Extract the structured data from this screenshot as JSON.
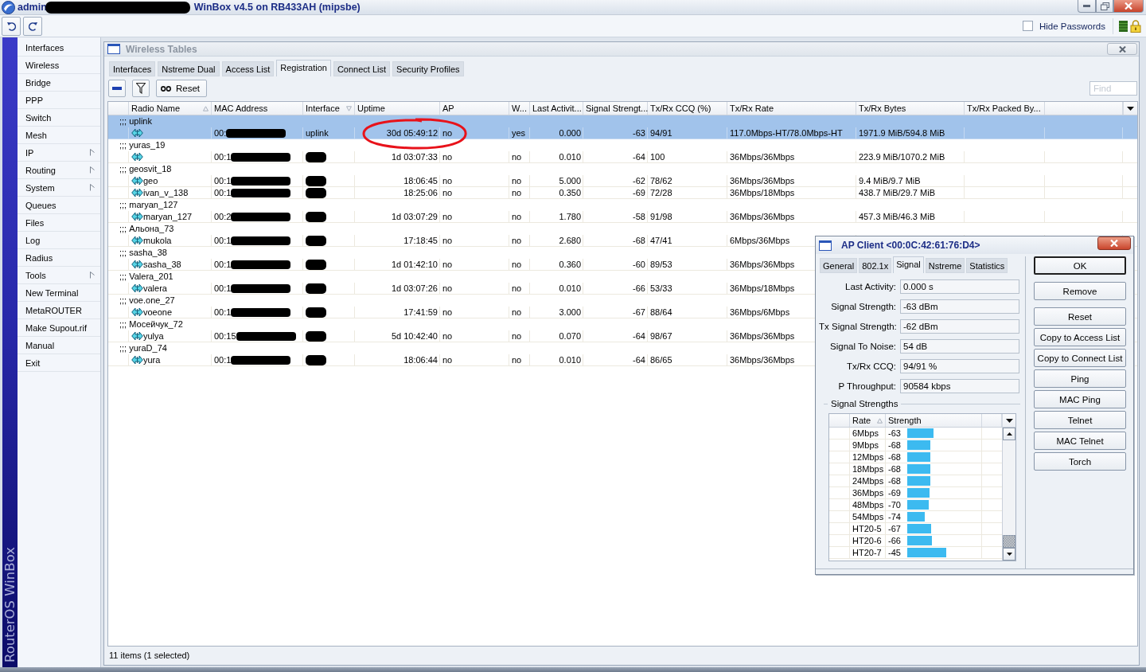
{
  "window": {
    "user": "admin",
    "title": "WinBox v4.5 on RB433AH (mipsbe)"
  },
  "toolbar": {
    "hide_passwords": {
      "label": "Hide Passwords",
      "checked": false
    }
  },
  "sidebar": {
    "brand": "RouterOS WinBox",
    "items": [
      {
        "label": "Interfaces",
        "submenu": false
      },
      {
        "label": "Wireless",
        "submenu": false
      },
      {
        "label": "Bridge",
        "submenu": false
      },
      {
        "label": "PPP",
        "submenu": false
      },
      {
        "label": "Switch",
        "submenu": false
      },
      {
        "label": "Mesh",
        "submenu": false
      },
      {
        "label": "IP",
        "submenu": true
      },
      {
        "label": "Routing",
        "submenu": true
      },
      {
        "label": "System",
        "submenu": true
      },
      {
        "label": "Queues",
        "submenu": false
      },
      {
        "label": "Files",
        "submenu": false
      },
      {
        "label": "Log",
        "submenu": false
      },
      {
        "label": "Radius",
        "submenu": false
      },
      {
        "label": "Tools",
        "submenu": true
      },
      {
        "label": "New Terminal",
        "submenu": false
      },
      {
        "label": "MetaROUTER",
        "submenu": false
      },
      {
        "label": "Make Supout.rif",
        "submenu": false
      },
      {
        "label": "Manual",
        "submenu": false
      },
      {
        "label": "Exit",
        "submenu": false
      }
    ]
  },
  "tables_window": {
    "title": "Wireless Tables",
    "tabs": [
      {
        "label": "Interfaces",
        "selected": false
      },
      {
        "label": "Nstreme Dual",
        "selected": false
      },
      {
        "label": "Access List",
        "selected": false
      },
      {
        "label": "Registration",
        "selected": true
      },
      {
        "label": "Connect List",
        "selected": false
      },
      {
        "label": "Security Profiles",
        "selected": false
      }
    ],
    "reset_label": "Reset",
    "find_placeholder": "Find",
    "columns": [
      {
        "label": "Radio Name",
        "sorted": true,
        "descending": false
      },
      {
        "label": "MAC Address",
        "sorted": false
      },
      {
        "label": "Interface",
        "sorted": true,
        "descending": true
      },
      {
        "label": "Uptime",
        "sorted": false
      },
      {
        "label": "AP",
        "sorted": false
      },
      {
        "label": "W...",
        "sorted": false
      },
      {
        "label": "Last Activit...",
        "sorted": false
      },
      {
        "label": "Signal Strengt...",
        "sorted": false
      },
      {
        "label": "Tx/Rx CCQ (%)",
        "sorted": false
      },
      {
        "label": "Tx/Rx Rate",
        "sorted": false
      },
      {
        "label": "Tx/Rx Bytes",
        "sorted": false
      },
      {
        "label": "Tx/Rx Packed By...",
        "sorted": false
      }
    ],
    "rows": [
      {
        "comment": ";;; uplink",
        "mac": "00:",
        "interface": "uplink",
        "uptime": "30d 05:49:12",
        "ap": "no",
        "w": "yes",
        "last_activity": "0.000",
        "signal": "-63",
        "ccq": "94/91",
        "rate": "117.0Mbps-HT/78.0Mbps-HT",
        "bytes": "1971.9 MiB/594.8 MiB",
        "selected": true
      },
      {
        "comment": ";;; yuras_19",
        "mac": "00:1",
        "uptime": "1d 03:07:33",
        "ap": "no",
        "w": "no",
        "last_activity": "0.010",
        "signal": "-64",
        "ccq": "100",
        "rate": "36Mbps/36Mbps",
        "bytes": "223.9 MiB/1070.2 MiB",
        "selected": false
      },
      {
        "comment": ";;; geosvit_18",
        "radio_name": "geo",
        "mac": "00:1",
        "uptime": "18:06:45",
        "ap": "no",
        "w": "no",
        "last_activity": "5.000",
        "signal": "-62",
        "ccq": "78/62",
        "rate": "36Mbps/36Mbps",
        "bytes": "9.4 MiB/9.7 MiB",
        "selected": false
      },
      {
        "radio_name": "ivan_v_138",
        "mac": "00:1",
        "uptime": "18:25:06",
        "ap": "no",
        "w": "no",
        "last_activity": "0.350",
        "signal": "-69",
        "ccq": "72/28",
        "rate": "36Mbps/18Mbps",
        "bytes": "438.7 MiB/29.7 MiB",
        "selected": false
      },
      {
        "comment": ";;; maryan_127",
        "radio_name": "maryan_127",
        "mac": "00:2",
        "uptime": "1d 03:07:29",
        "ap": "no",
        "w": "no",
        "last_activity": "1.780",
        "signal": "-58",
        "ccq": "91/98",
        "rate": "36Mbps/36Mbps",
        "bytes": "457.3 MiB/46.3 MiB",
        "selected": false
      },
      {
        "comment": ";;; Альона_73",
        "radio_name": "mukola",
        "mac": "00:1",
        "uptime": "17:18:45",
        "ap": "no",
        "w": "no",
        "last_activity": "2.680",
        "signal": "-68",
        "ccq": "47/41",
        "rate": "6Mbps/36Mbps",
        "selected": false
      },
      {
        "comment": ";;; sasha_38",
        "radio_name": "sasha_38",
        "mac": "00:1",
        "uptime": "1d 01:42:10",
        "ap": "no",
        "w": "no",
        "last_activity": "0.360",
        "signal": "-60",
        "ccq": "89/53",
        "rate": "36Mbps/36Mbps",
        "selected": false
      },
      {
        "comment": ";;; Valera_201",
        "radio_name": "valera",
        "mac": "00:1",
        "uptime": "1d 03:07:26",
        "ap": "no",
        "w": "no",
        "last_activity": "0.010",
        "signal": "-66",
        "ccq": "53/33",
        "rate": "36Mbps/18Mbps",
        "selected": false
      },
      {
        "comment": ";;; voe.one_27",
        "radio_name": "voeone",
        "mac": "00:1",
        "uptime": "17:41:59",
        "ap": "no",
        "w": "no",
        "last_activity": "3.000",
        "signal": "-67",
        "ccq": "88/64",
        "rate": "36Mbps/6Mbps",
        "selected": false
      },
      {
        "comment": ";;; Мосейчук_72",
        "radio_name": "yulya",
        "mac": "00:15",
        "uptime": "5d 10:42:40",
        "ap": "no",
        "w": "no",
        "last_activity": "0.070",
        "signal": "-64",
        "ccq": "98/67",
        "rate": "36Mbps/36Mbps",
        "selected": false
      },
      {
        "comment": ";;; yuraD_74",
        "radio_name": "yura",
        "mac": "00:1",
        "uptime": "18:06:44",
        "ap": "no",
        "w": "no",
        "last_activity": "0.010",
        "signal": "-64",
        "ccq": "86/65",
        "rate": "36Mbps/36Mbps",
        "selected": false
      }
    ],
    "status": "11 items (1 selected)"
  },
  "ap_client": {
    "title": "AP Client <00:0C:42:61:76:D4>",
    "tabs": [
      {
        "label": "General",
        "selected": false
      },
      {
        "label": "802.1x",
        "selected": false
      },
      {
        "label": "Signal",
        "selected": true
      },
      {
        "label": "Nstreme",
        "selected": false
      },
      {
        "label": "Statistics",
        "selected": false
      }
    ],
    "fields": [
      {
        "label": "Last Activity:",
        "value": "0.000 s"
      },
      {
        "label": "Signal Strength:",
        "value": "-63 dBm"
      },
      {
        "label": "Tx Signal Strength:",
        "value": "-62 dBm"
      },
      {
        "label": "Signal To Noise:",
        "value": "54 dB"
      },
      {
        "label": "Tx/Rx CCQ:",
        "value": "94/91 %"
      },
      {
        "label": "P Throughput:",
        "value": "90584 kbps"
      }
    ],
    "group_title": "Signal Strengths",
    "columns": [
      {
        "label": "Rate",
        "sorted": true,
        "descending": false
      },
      {
        "label": "Strength",
        "sorted": false
      }
    ],
    "strengths": [
      {
        "rate": "6Mbps",
        "value": "-63",
        "level": 0.36
      },
      {
        "rate": "9Mbps",
        "value": "-68",
        "level": 0.31
      },
      {
        "rate": "12Mbps",
        "value": "-68",
        "level": 0.31
      },
      {
        "rate": "18Mbps",
        "value": "-68",
        "level": 0.31
      },
      {
        "rate": "24Mbps",
        "value": "-68",
        "level": 0.31
      },
      {
        "rate": "36Mbps",
        "value": "-69",
        "level": 0.3
      },
      {
        "rate": "48Mbps",
        "value": "-70",
        "level": 0.29
      },
      {
        "rate": "54Mbps",
        "value": "-74",
        "level": 0.24
      },
      {
        "rate": "HT20-5",
        "value": "-67",
        "level": 0.32
      },
      {
        "rate": "HT20-6",
        "value": "-66",
        "level": 0.33
      },
      {
        "rate": "HT20-7",
        "value": "-45",
        "level": 0.53
      }
    ],
    "buttons": [
      {
        "label": "OK",
        "default": true
      },
      {
        "label": "Remove",
        "default": false
      },
      {
        "label": "Reset",
        "default": false
      },
      {
        "label": "Copy to Access List",
        "default": false
      },
      {
        "label": "Copy to Connect List",
        "default": false
      },
      {
        "label": "Ping",
        "default": false
      },
      {
        "label": "MAC Ping",
        "default": false
      },
      {
        "label": "Telnet",
        "default": false
      },
      {
        "label": "MAC Telnet",
        "default": false
      },
      {
        "label": "Torch",
        "default": false
      }
    ]
  }
}
